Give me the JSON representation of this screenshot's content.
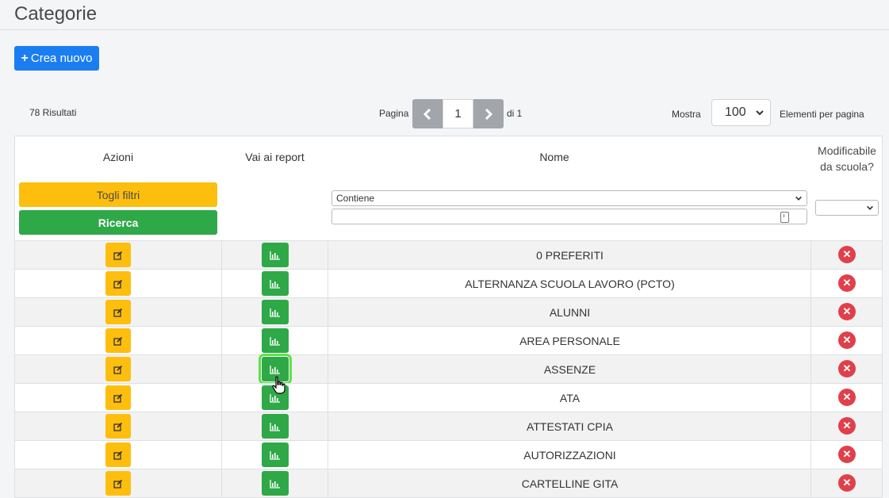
{
  "page": {
    "title": "Categorie"
  },
  "toolbar": {
    "create_label": "Crea nuovo"
  },
  "pagination": {
    "results": "78 Risultati",
    "page_label": "Pagina",
    "current_page": "1",
    "of_label": "di 1",
    "show_label": "Mostra",
    "per_page_value": "100",
    "per_page_suffix": "Elementi per pagina"
  },
  "table": {
    "headers": {
      "actions": "Azioni",
      "report": "Vai ai report",
      "name": "Nome",
      "editable": "Modificabile da scuola?"
    },
    "filters": {
      "reset_label": "Togli filtri",
      "search_label": "Ricerca",
      "name_operator": "Contiene",
      "name_value": "",
      "editable_value": ""
    },
    "rows": [
      {
        "name": "0 PREFERITI"
      },
      {
        "name": "ALTERNANZA SCUOLA LAVORO (PCTO)"
      },
      {
        "name": "ALUNNI"
      },
      {
        "name": "AREA PERSONALE"
      },
      {
        "name": "ASSENZE"
      },
      {
        "name": "ATA"
      },
      {
        "name": "ATTESTATI CPIA"
      },
      {
        "name": "AUTORIZZAZIONI"
      },
      {
        "name": "CARTELLINE GITA"
      }
    ]
  },
  "icons": {
    "edit": "edit-icon",
    "report": "bar-chart-icon",
    "delete": "x-circle-icon",
    "cursor": "hand-pointer-icon"
  },
  "colors": {
    "primary": "#1a7ef0",
    "warning": "#fdbe0e",
    "success": "#2fa848",
    "danger": "#e0404b",
    "highlight": "#5fe04a"
  }
}
